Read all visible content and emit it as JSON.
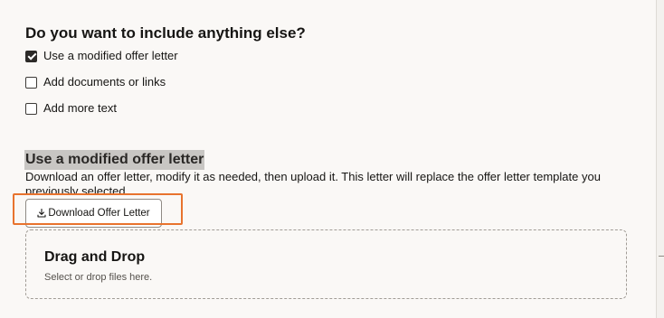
{
  "section": {
    "title": "Do you want to include anything else?",
    "options": [
      {
        "label": "Use a modified offer letter",
        "checked": true
      },
      {
        "label": "Add documents or links",
        "checked": false
      },
      {
        "label": "Add more text",
        "checked": false
      }
    ]
  },
  "modified_letter": {
    "title": "Use a modified offer letter",
    "description": "Download an offer letter, modify it as needed, then upload it. This letter will replace the offer letter template you previously selected.",
    "download_button_label": "Download Offer Letter",
    "download_icon": "download-icon"
  },
  "dropzone": {
    "title": "Drag and Drop",
    "hint": "Select or drop files here."
  },
  "colors": {
    "highlight": "#e8732e",
    "checkbox_checked": "#2c2a28",
    "title_highlight_bg": "#c8c6c3"
  }
}
